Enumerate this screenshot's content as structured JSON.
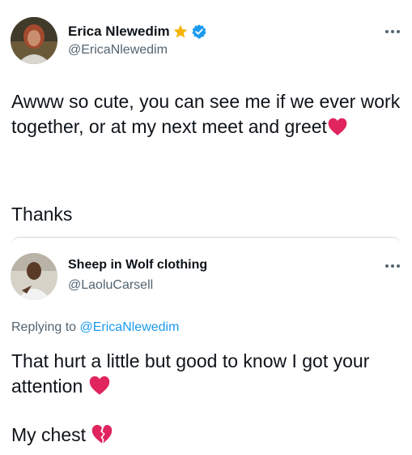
{
  "tweet": {
    "author": {
      "display_name": "Erica Nlewedim",
      "handle": "@EricaNlewedim",
      "badges": [
        "star-icon",
        "verified-icon"
      ]
    },
    "paragraphs": [
      "Awww so cute, you can see me if we ever work together, or at my next meet and greet",
      "Thanks"
    ],
    "more_icon": "more-icon"
  },
  "reply": {
    "author": {
      "display_name": "Sheep in Wolf clothing",
      "handle": "@LaoluCarsell"
    },
    "replying_to_prefix": "Replying to",
    "replying_to_handle": "@EricaNlewedim",
    "paragraphs": [
      "That hurt a little but good to know I got your attention",
      "My chest"
    ],
    "more_icon": "more-icon"
  },
  "colors": {
    "text": "#0f1419",
    "secondary": "#536471",
    "accent": "#1d9bf0",
    "heart": "#e0245e",
    "star": "#f4b400"
  }
}
